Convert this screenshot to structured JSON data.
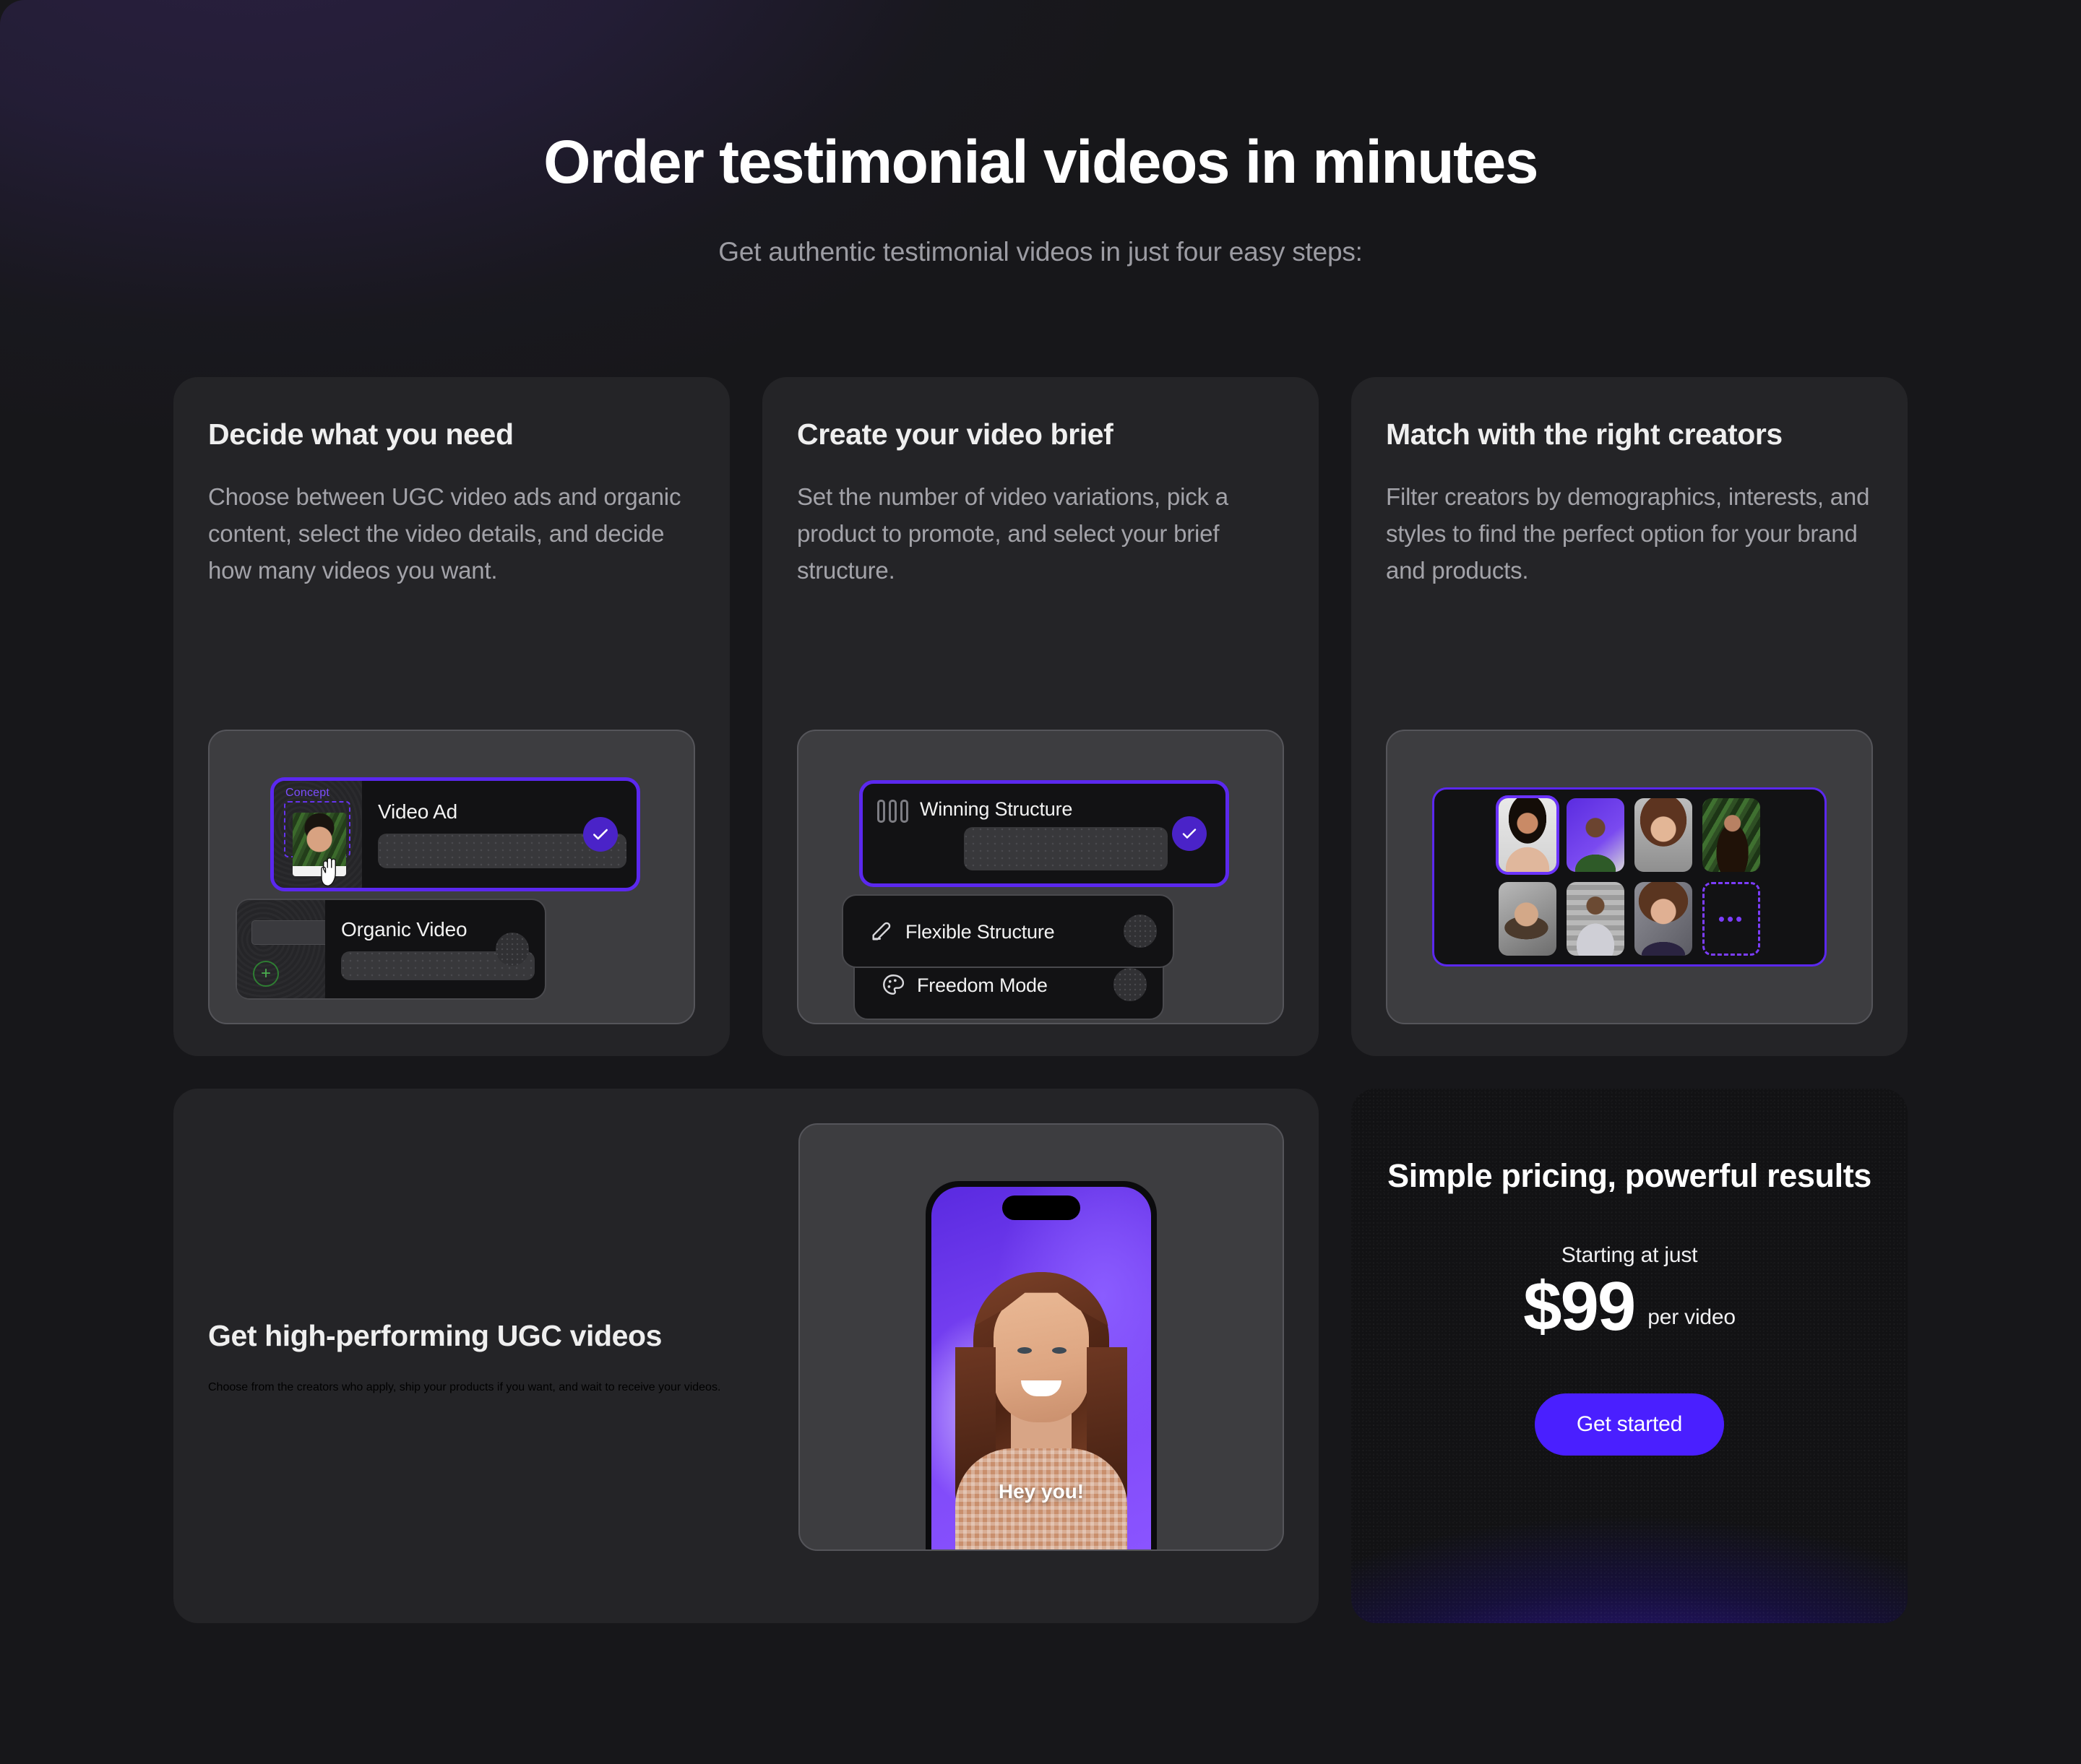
{
  "hero": {
    "title": "Order testimonial videos in minutes",
    "subtitle": "Get authentic testimonial videos in just four easy steps:"
  },
  "colors": {
    "accent_purple": "#4a1fff",
    "selection_border": "#5b28ef",
    "check_badge": "#4a23c8",
    "page_background": "#17171a",
    "card_background": "#242427",
    "panel_background": "#3d3d40",
    "heading_text": "#efefef",
    "body_text": "#a3a3a9",
    "concept_label": "#7c4dff",
    "plus_green": "#4caf50"
  },
  "steps": [
    {
      "title": "Decide what you need",
      "desc": "Choose between UGC video ads and organic content, select the video details, and decide how many videos you want.",
      "mockup": {
        "type": "option-list",
        "options": [
          {
            "label": "Video Ad",
            "selected": true,
            "badge": "check"
          },
          {
            "label": "Organic Video",
            "selected": false,
            "badge": "toggle"
          }
        ],
        "thumb_label": "Concept",
        "cursor": "hand-cursor"
      }
    },
    {
      "title": "Create your video brief",
      "desc": "Set the number of video variations, pick a product to promote, and select your brief structure.",
      "mockup": {
        "type": "option-list",
        "options": [
          {
            "label": "Winning Structure",
            "selected": true,
            "badge": "check",
            "icon": "three-bars-icon"
          },
          {
            "label": "Flexible Structure",
            "selected": false,
            "badge": "toggle",
            "icon": "pencil-icon"
          },
          {
            "label": "Freedom Mode",
            "selected": false,
            "badge": "toggle",
            "icon": "palette-icon"
          }
        ]
      }
    },
    {
      "title": "Match with the right creators",
      "desc": "Filter creators by demographics, interests, and styles to find the perfect option for your brand and products.",
      "mockup": {
        "type": "creator-grid",
        "count": 7,
        "selected_index": 0,
        "more_label": "•••"
      }
    },
    {
      "title": "Get high-performing UGC videos",
      "desc": "Choose from the creators who apply, ship your products if you want, and wait to receive your videos.",
      "mockup": {
        "type": "phone-preview",
        "caption": "Hey you!"
      }
    }
  ],
  "pricing": {
    "title": "Simple pricing, powerful results",
    "starting_label": "Starting at just",
    "price": "$99",
    "per_unit": "per video",
    "cta_label": "Get started"
  }
}
